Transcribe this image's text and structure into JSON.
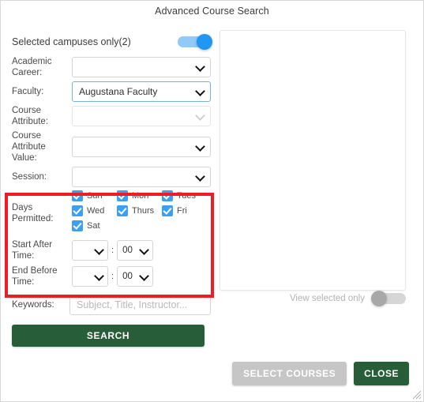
{
  "dialog": {
    "title": "Advanced Course Search"
  },
  "campus_toggle": {
    "label": "Selected campuses only(2)",
    "state": "on",
    "color_on": "#2196f3",
    "track_on": "#90caf9"
  },
  "fields": [
    {
      "label": "Academic Career:",
      "value": "",
      "state": "enabled"
    },
    {
      "label": "Faculty:",
      "value": "Augustana Faculty",
      "state": "focused"
    },
    {
      "label": "Course Attribute:",
      "value": "",
      "state": "disabled"
    },
    {
      "label": "Course Attribute Value:",
      "value": "",
      "state": "enabled"
    },
    {
      "label": "Session:",
      "value": "",
      "state": "enabled"
    }
  ],
  "days": {
    "label": "Days Permitted:",
    "items": [
      {
        "name": "Sun",
        "checked": true
      },
      {
        "name": "Mon",
        "checked": true
      },
      {
        "name": "Tues",
        "checked": true
      },
      {
        "name": "Wed",
        "checked": true
      },
      {
        "name": "Thurs",
        "checked": true
      },
      {
        "name": "Fri",
        "checked": true
      },
      {
        "name": "Sat",
        "checked": true
      }
    ],
    "checkbox_color": "#3aa0ef"
  },
  "times": {
    "start": {
      "label": "Start After Time:",
      "hour": "",
      "separator": ":",
      "minute": "00"
    },
    "end": {
      "label": "End Before Time:",
      "hour": "",
      "separator": ":",
      "minute": "00"
    }
  },
  "keywords": {
    "label": "Keywords:",
    "value": "",
    "placeholder": "Subject, Title, Instructor..."
  },
  "search_button": {
    "label": "SEARCH",
    "color": "#275d38"
  },
  "results_panel": {
    "content": ""
  },
  "view_selected": {
    "label": "View selected only",
    "state": "off",
    "color_off": "#a8a8a8"
  },
  "footer": {
    "select_courses_label": "SELECT COURSES",
    "select_courses_state": "disabled",
    "close_label": "CLOSE",
    "close_color": "#275d38"
  },
  "highlight": {
    "color": "#ee1c24"
  }
}
